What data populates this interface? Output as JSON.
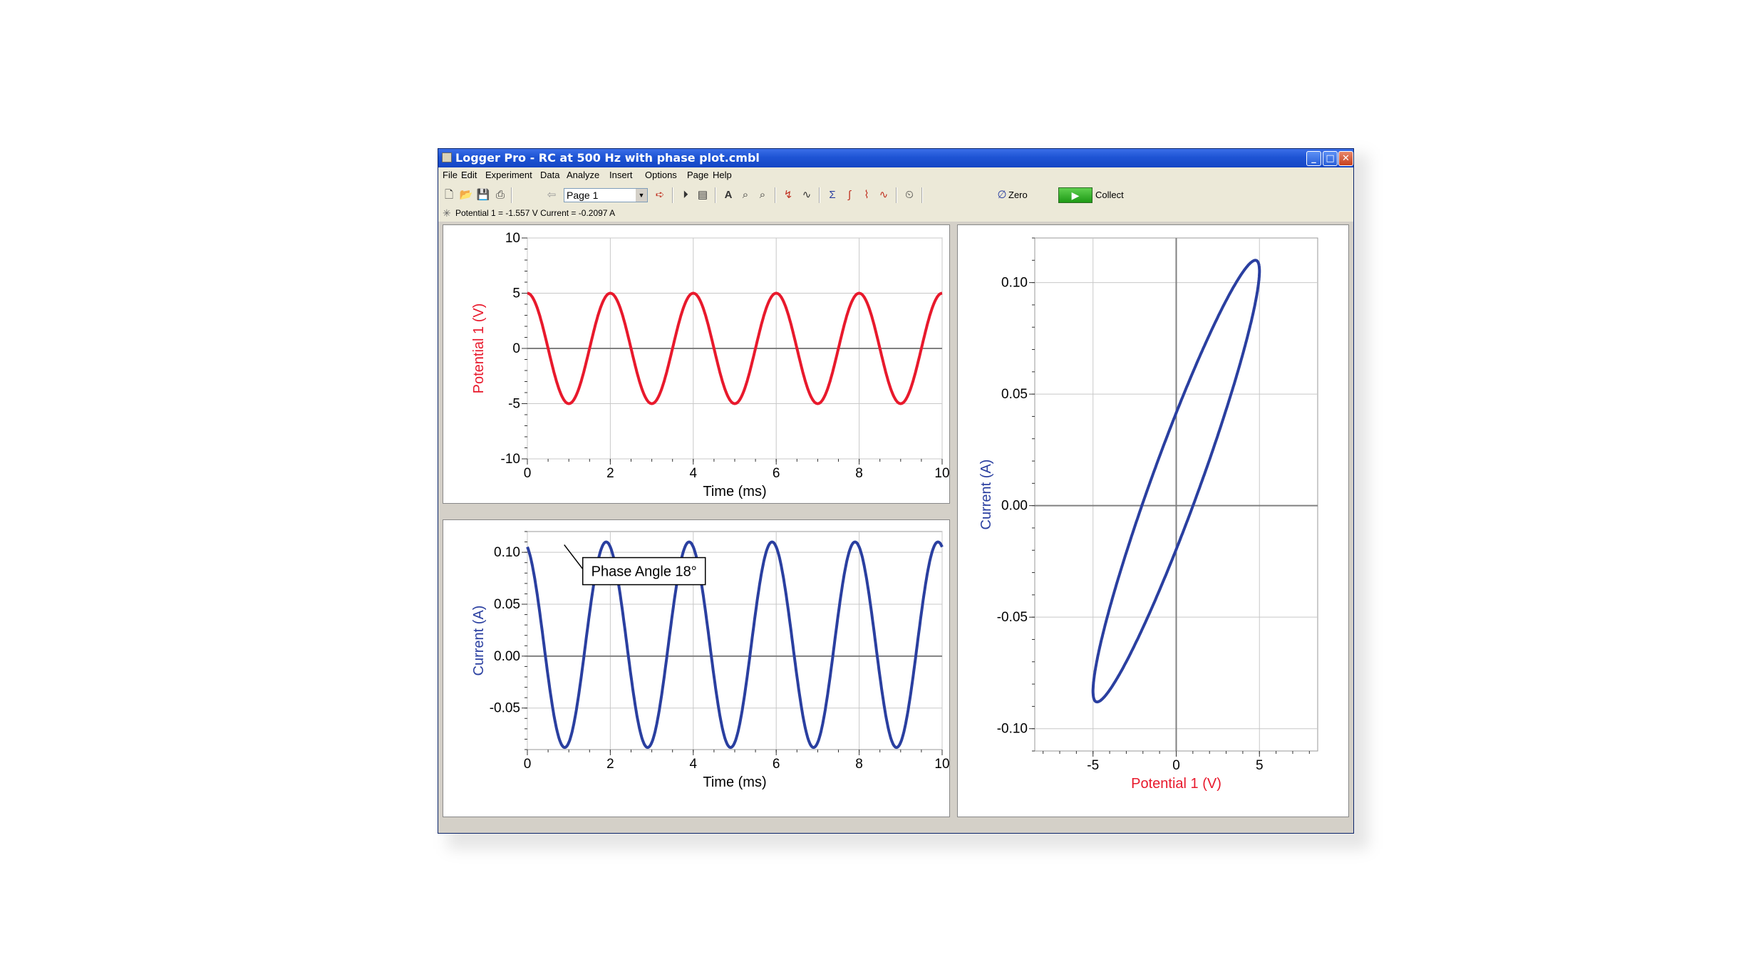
{
  "window": {
    "title": "Logger Pro - RC at 500 Hz with phase plot.cmbl",
    "buttons": {
      "minimize": "_",
      "maximize": "□",
      "close": "✕"
    }
  },
  "menu": [
    "File",
    "Edit",
    "Experiment",
    "Data",
    "Analyze",
    "Insert",
    "Options",
    "Page",
    "Help"
  ],
  "toolbar": {
    "page_select": "Page 1",
    "zero_label": "Zero",
    "collect_label": "Collect",
    "icons": [
      "new-file-icon",
      "open-folder-icon",
      "save-icon",
      "print-icon",
      "page-back-icon",
      "page-select",
      "page-forward-icon",
      "autoscale-icon",
      "examine-icon",
      "zoom-in-icon",
      "zoom-out-icon",
      "tangent-icon",
      "model-icon",
      "statistics-icon",
      "integral-icon",
      "curve-fit-icon",
      "fft-icon",
      "timer-icon",
      "zero-icon",
      "collect-icon"
    ]
  },
  "status": {
    "readout": "Potential 1 =  -1.557 V   Current =  -0.2097 A"
  },
  "colors": {
    "potential": "#e8192c",
    "current": "#2a3fa0",
    "grid": "#c8c8c8",
    "axis": "#808080"
  },
  "chart_data": [
    {
      "type": "line",
      "xlabel": "Time (ms)",
      "ylabel": "Potential 1 (V)",
      "xlim": [
        0,
        10
      ],
      "ylim": [
        -10,
        10
      ],
      "xticks": [
        0,
        2,
        4,
        6,
        8,
        10
      ],
      "yticks": [
        -10,
        -5,
        0,
        5,
        10
      ],
      "yticklabels": [
        "-10",
        "-5",
        "0",
        "5",
        "10"
      ],
      "series": [
        {
          "function": "5*cos(2*pi*0.5*t)",
          "amplitude": 5,
          "frequency_per_ms": 0.5,
          "phase_deg": 0
        }
      ]
    },
    {
      "type": "line",
      "xlabel": "Time (ms)",
      "ylabel": "Current (A)",
      "xlim": [
        0,
        10
      ],
      "ylim": [
        -0.09,
        0.12
      ],
      "xticks": [
        0,
        2,
        4,
        6,
        8,
        10
      ],
      "yticks": [
        -0.05,
        0.0,
        0.05,
        0.1
      ],
      "yticklabels": [
        "-0.05",
        "0.00",
        "0.05",
        "0.10"
      ],
      "annotation": {
        "text": "Phase Angle 18°",
        "x": 0.82,
        "y": 0.11
      },
      "series": [
        {
          "function": "0.099*cos(2*pi*0.5*t + 18deg) + 0.011",
          "amplitude": 0.099,
          "offset": 0.011,
          "frequency_per_ms": 0.5,
          "phase_deg": 18
        }
      ]
    },
    {
      "type": "line",
      "xlabel": "Potential 1 (V)",
      "ylabel": "Current (A)",
      "xlim": [
        -8.5,
        8.5
      ],
      "ylim": [
        -0.11,
        0.12
      ],
      "xticks": [
        -5,
        0,
        5
      ],
      "xticklabels": [
        "-5",
        "0",
        "5"
      ],
      "yticks": [
        -0.1,
        -0.05,
        0.0,
        0.05,
        0.1
      ],
      "yticklabels": [
        "-0.10",
        "-0.05",
        "0.00",
        "0.05",
        "0.10"
      ],
      "series": [
        {
          "description": "phase plot ellipse of current vs potential"
        }
      ]
    }
  ]
}
